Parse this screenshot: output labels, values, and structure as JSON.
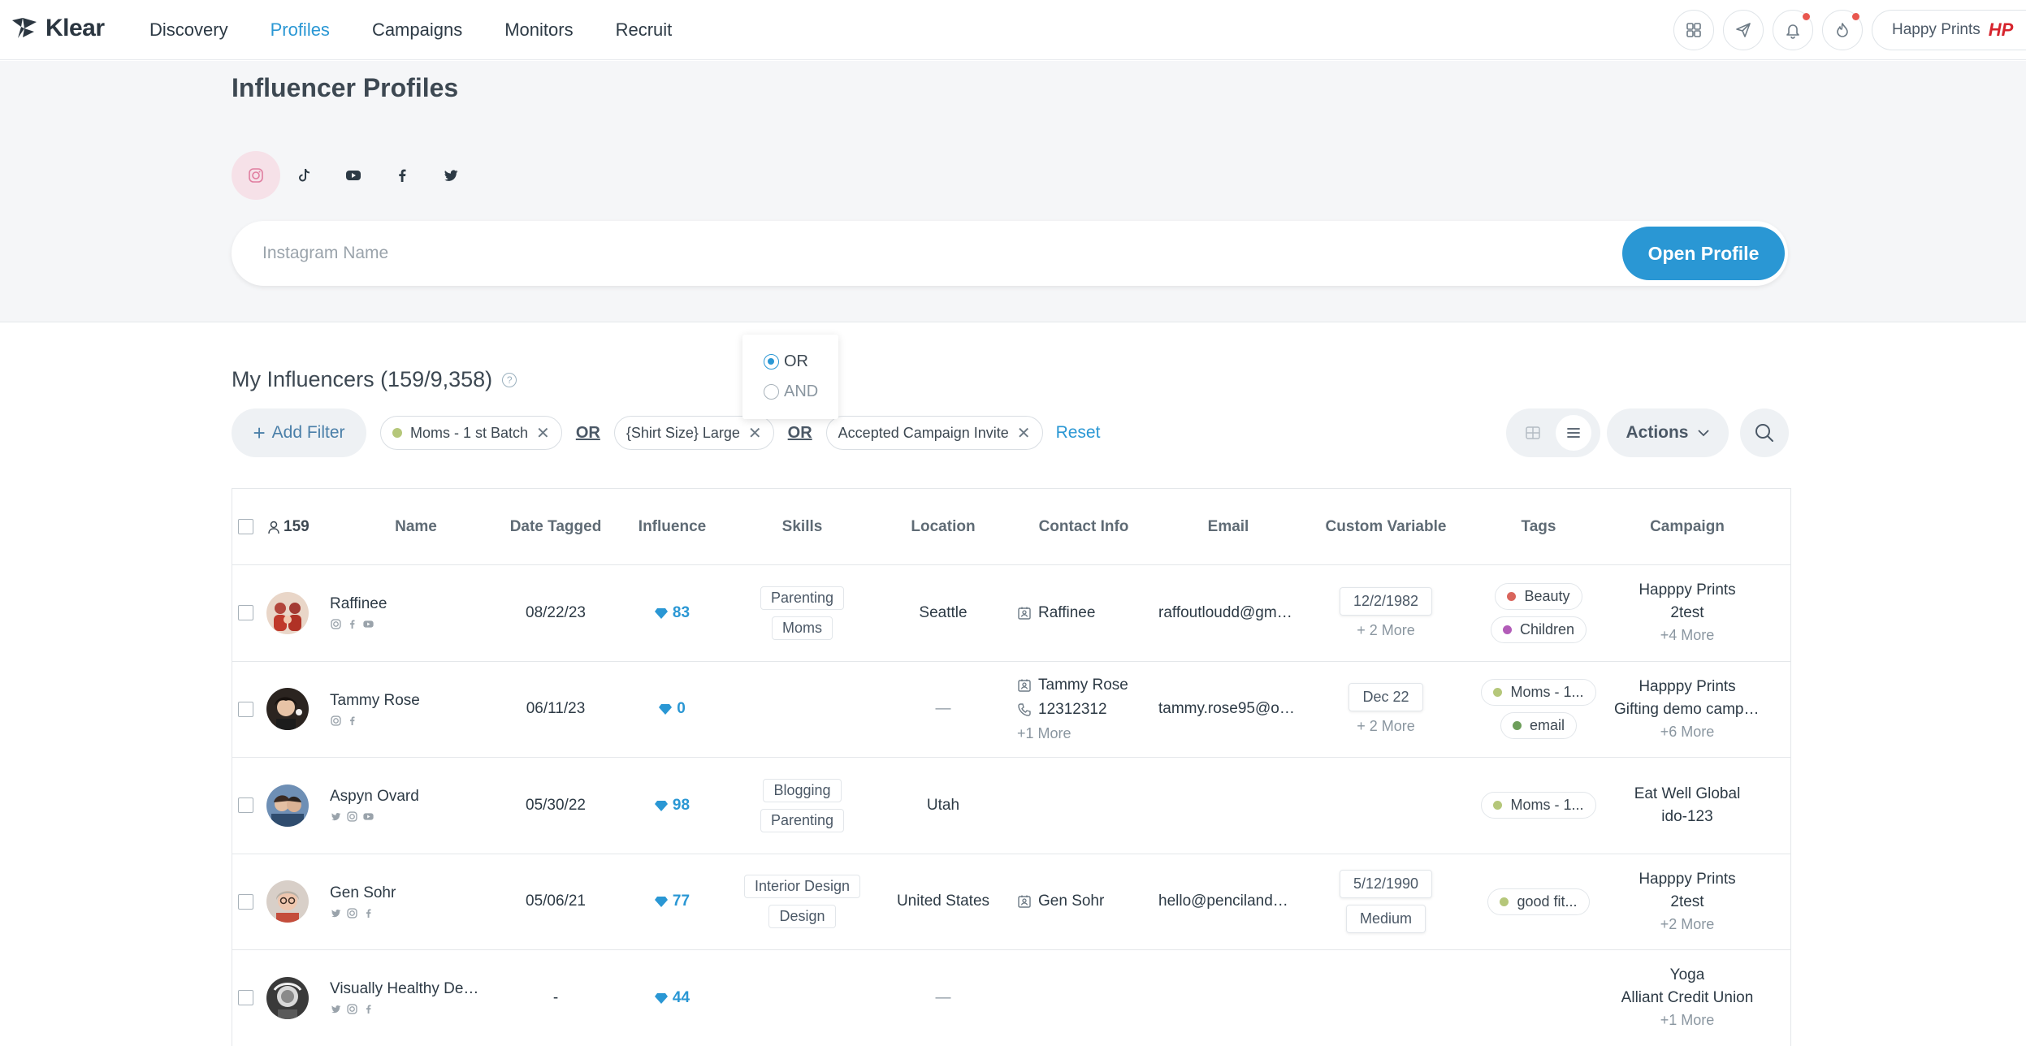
{
  "nav": {
    "logo_text": "Klear",
    "links": [
      "Discovery",
      "Profiles",
      "Campaigns",
      "Monitors",
      "Recruit"
    ],
    "active_link": "Profiles",
    "account_name": "Happy Prints",
    "account_logo_text": "HP"
  },
  "header": {
    "title": "Influencer Profiles",
    "platforms": [
      "instagram",
      "tiktok",
      "youtube",
      "facebook",
      "twitter"
    ],
    "search_placeholder": "Instagram Name",
    "open_profile_label": "Open Profile"
  },
  "logic_popover": {
    "options": [
      "OR",
      "AND"
    ],
    "selected": "OR"
  },
  "influencers": {
    "title": "My Influencers (159/9,358)",
    "add_filter_label": "Add Filter",
    "filters": [
      {
        "label": "Moms - 1 st Batch",
        "dot_color": "#b5c77a"
      },
      {
        "label": "{Shirt Size} Large",
        "dot_color": ""
      },
      {
        "label": "Accepted Campaign Invite",
        "dot_color": ""
      }
    ],
    "operator_1": "OR",
    "operator_2": "OR",
    "reset_label": "Reset",
    "actions_label": "Actions"
  },
  "table": {
    "count": "159",
    "columns": {
      "name": "Name",
      "date": "Date Tagged",
      "influence": "Influence",
      "skills": "Skills",
      "location": "Location",
      "contact": "Contact Info",
      "email": "Email",
      "custom": "Custom Variable",
      "tags": "Tags",
      "campaign": "Campaign"
    },
    "rows": [
      {
        "name": "Raffinee",
        "date": "08/22/23",
        "influence": "83",
        "skills": [
          "Parenting",
          "Moms"
        ],
        "location": "Seattle",
        "contact_name": "Raffinee",
        "contact_phone": "",
        "contact_more": "",
        "email": "raffoutloudd@gma...",
        "custom": [
          "12/2/1982"
        ],
        "custom_more": "+ 2 More",
        "tags": [
          {
            "label": "Beauty",
            "color": "#d9655c"
          },
          {
            "label": "Children",
            "color": "#b25cb8"
          }
        ],
        "campaign": [
          "Happpy Prints",
          "2test"
        ],
        "campaign_more": "+4 More"
      },
      {
        "name": "Tammy Rose",
        "date": "06/11/23",
        "influence": "0",
        "skills": [],
        "location": "—",
        "contact_name": "Tammy Rose",
        "contact_phone": "12312312",
        "contact_more": "+1 More",
        "email": "tammy.rose95@ou...",
        "custom": [
          "Dec 22"
        ],
        "custom_more": "+ 2 More",
        "tags": [
          {
            "label": "Moms - 1...",
            "color": "#b5c77a"
          },
          {
            "label": "email",
            "color": "#6d9e5a"
          }
        ],
        "campaign": [
          "Happpy Prints",
          "Gifting demo campa..."
        ],
        "campaign_more": "+6 More"
      },
      {
        "name": "Aspyn Ovard",
        "date": "05/30/22",
        "influence": "98",
        "skills": [
          "Blogging",
          "Parenting"
        ],
        "location": "Utah",
        "contact_name": "",
        "contact_phone": "",
        "contact_more": "",
        "email": "",
        "custom": [],
        "custom_more": "",
        "tags": [
          {
            "label": "Moms - 1...",
            "color": "#b5c77a"
          }
        ],
        "campaign": [
          "Eat Well Global",
          "ido-123"
        ],
        "campaign_more": ""
      },
      {
        "name": "Gen Sohr",
        "date": "05/06/21",
        "influence": "77",
        "skills": [
          "Interior Design",
          "Design"
        ],
        "location": "United States",
        "contact_name": "Gen Sohr",
        "contact_phone": "",
        "contact_more": "",
        "email": "hello@pencilandpa...",
        "custom": [
          "5/12/1990",
          "Medium"
        ],
        "custom_more": "",
        "tags": [
          {
            "label": "good fit...",
            "color": "#b5c77a"
          }
        ],
        "campaign": [
          "Happpy Prints",
          "2test"
        ],
        "campaign_more": "+2 More"
      },
      {
        "name": "Visually Healthy Des...",
        "date": "-",
        "influence": "44",
        "skills": [],
        "location": "—",
        "contact_name": "",
        "contact_phone": "",
        "contact_more": "",
        "email": "",
        "custom": [],
        "custom_more": "",
        "tags": [],
        "campaign": [
          "Yoga",
          "Alliant Credit Union"
        ],
        "campaign_more": "+1 More"
      }
    ]
  }
}
